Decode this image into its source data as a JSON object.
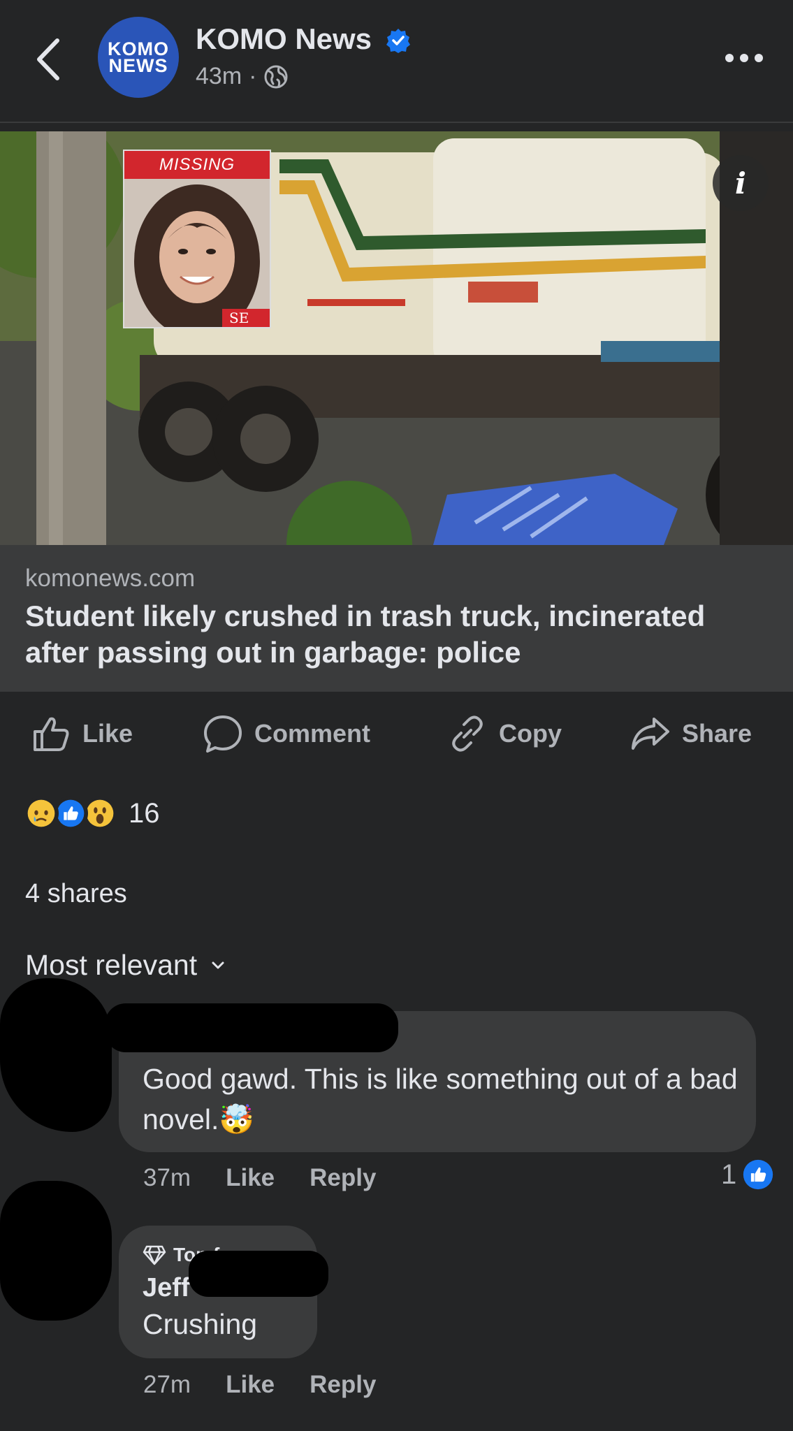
{
  "header": {
    "avatar_line1": "KOMO",
    "avatar_line2": "NEWS",
    "page_name": "KOMO News",
    "timestamp": "43m",
    "separator": "·",
    "privacy_icon": "globe-icon"
  },
  "photo": {
    "missing_label": "MISSING",
    "card_caption": "SE"
  },
  "link": {
    "domain": "komonews.com",
    "headline": "Student likely crushed in trash truck, incinerated after passing out in garbage: police"
  },
  "actions": {
    "like": "Like",
    "comment": "Comment",
    "copy": "Copy",
    "share": "Share"
  },
  "reactions": {
    "icons": [
      "sad-icon",
      "like-icon",
      "wow-icon"
    ],
    "count": "16"
  },
  "shares": "4 shares",
  "sort": {
    "label": "Most relevant"
  },
  "comments": [
    {
      "text": "Good gawd. This is like something out of a bad novel.",
      "emoji": "🤯",
      "time": "37m",
      "like": "Like",
      "reply": "Reply",
      "like_count": "1"
    },
    {
      "badge": "Top f",
      "name": "Jeff",
      "text": "Crushing",
      "time": "27m",
      "like": "Like",
      "reply": "Reply"
    }
  ],
  "colors": {
    "background": "#242526",
    "surface": "#3a3b3c",
    "text_primary": "#e4e6eb",
    "text_secondary": "#b0b3b8",
    "verified_blue": "#1877f2"
  }
}
